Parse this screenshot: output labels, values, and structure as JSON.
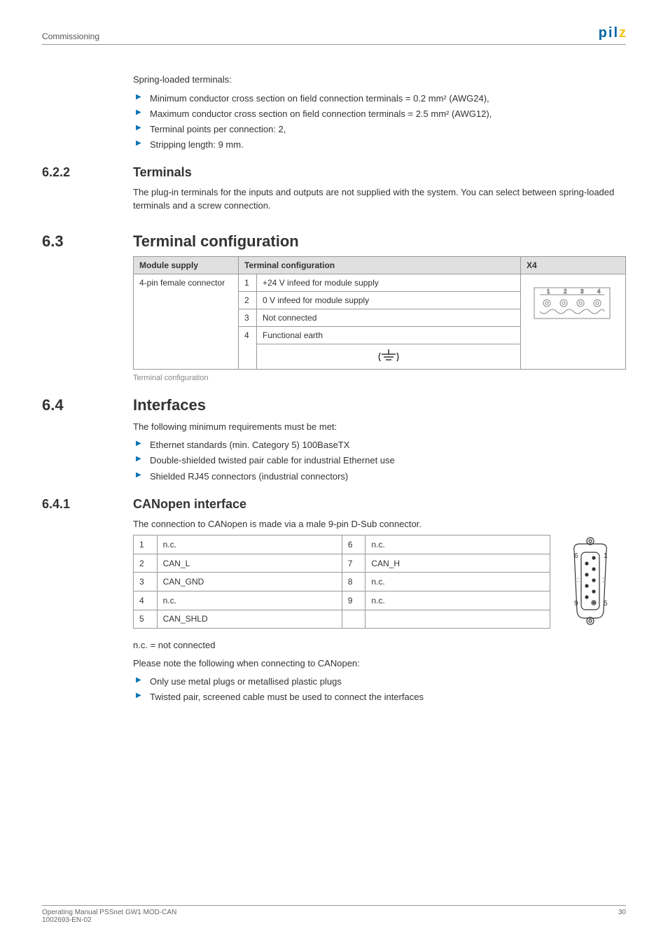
{
  "header": {
    "left": "Commissioning",
    "logo": {
      "p": "p",
      "i": "i",
      "l": "l",
      "z": "z"
    }
  },
  "intro": {
    "lead": "Spring-loaded terminals:",
    "items": [
      "Minimum conductor cross section on field connection terminals = 0.2 mm² (AWG24),",
      "Maximum conductor cross section on field connection terminals = 2.5 mm² (AWG12),",
      "Terminal points per connection: 2,",
      "Stripping length: 9 mm."
    ]
  },
  "s622": {
    "num": "6.2.2",
    "title": "Terminals",
    "body": "The plug-in terminals for the inputs and outputs are not supplied with the system. You can select between spring-loaded terminals and a screw connection."
  },
  "s63": {
    "num": "6.3",
    "title": "Terminal configuration",
    "table": {
      "h1": "Module supply",
      "h2": "Terminal configuration",
      "h3": "X4",
      "rowlabel": "4-pin female connector",
      "rows": [
        {
          "n": "1",
          "desc": "+24 V infeed for module supply"
        },
        {
          "n": "2",
          "desc": "0 V infeed for module supply"
        },
        {
          "n": "3",
          "desc": "Not connected"
        },
        {
          "n": "4",
          "desc": "Functional earth"
        }
      ]
    },
    "caption": "Terminal configuration"
  },
  "s64": {
    "num": "6.4",
    "title": "Interfaces",
    "lead": "The following minimum requirements must be met:",
    "items": [
      "Ethernet standards (min. Category 5) 100BaseTX",
      "Double-shielded twisted pair cable for industrial Ethernet use",
      "Shielded RJ45 connectors (industrial connectors)"
    ]
  },
  "s641": {
    "num": "6.4.1",
    "title": "CANopen interface",
    "lead": "The connection to CANopen is made via a male 9-pin D-Sub connector.",
    "pins": {
      "left": [
        {
          "n": "1",
          "name": "n.c."
        },
        {
          "n": "2",
          "name": "CAN_L"
        },
        {
          "n": "3",
          "name": "CAN_GND"
        },
        {
          "n": "4",
          "name": "n.c."
        },
        {
          "n": "5",
          "name": "CAN_SHLD"
        }
      ],
      "right": [
        {
          "n": "6",
          "name": "n.c."
        },
        {
          "n": "7",
          "name": "CAN_H"
        },
        {
          "n": "8",
          "name": "n.c."
        },
        {
          "n": "9",
          "name": "n.c."
        }
      ],
      "labels": {
        "tl": "6",
        "tr": "1",
        "bl": "9",
        "br": "5"
      }
    },
    "note": "n.c. = not connected",
    "lead2": "Please note the following when connecting to CANopen:",
    "items2": [
      "Only use metal plugs or metallised plastic plugs",
      "Twisted pair, screened cable must be used to connect the interfaces"
    ]
  },
  "footer": {
    "left1": "Operating Manual PSSnet GW1 MOD-CAN",
    "left2": "1002693-EN-02",
    "right": "30"
  }
}
